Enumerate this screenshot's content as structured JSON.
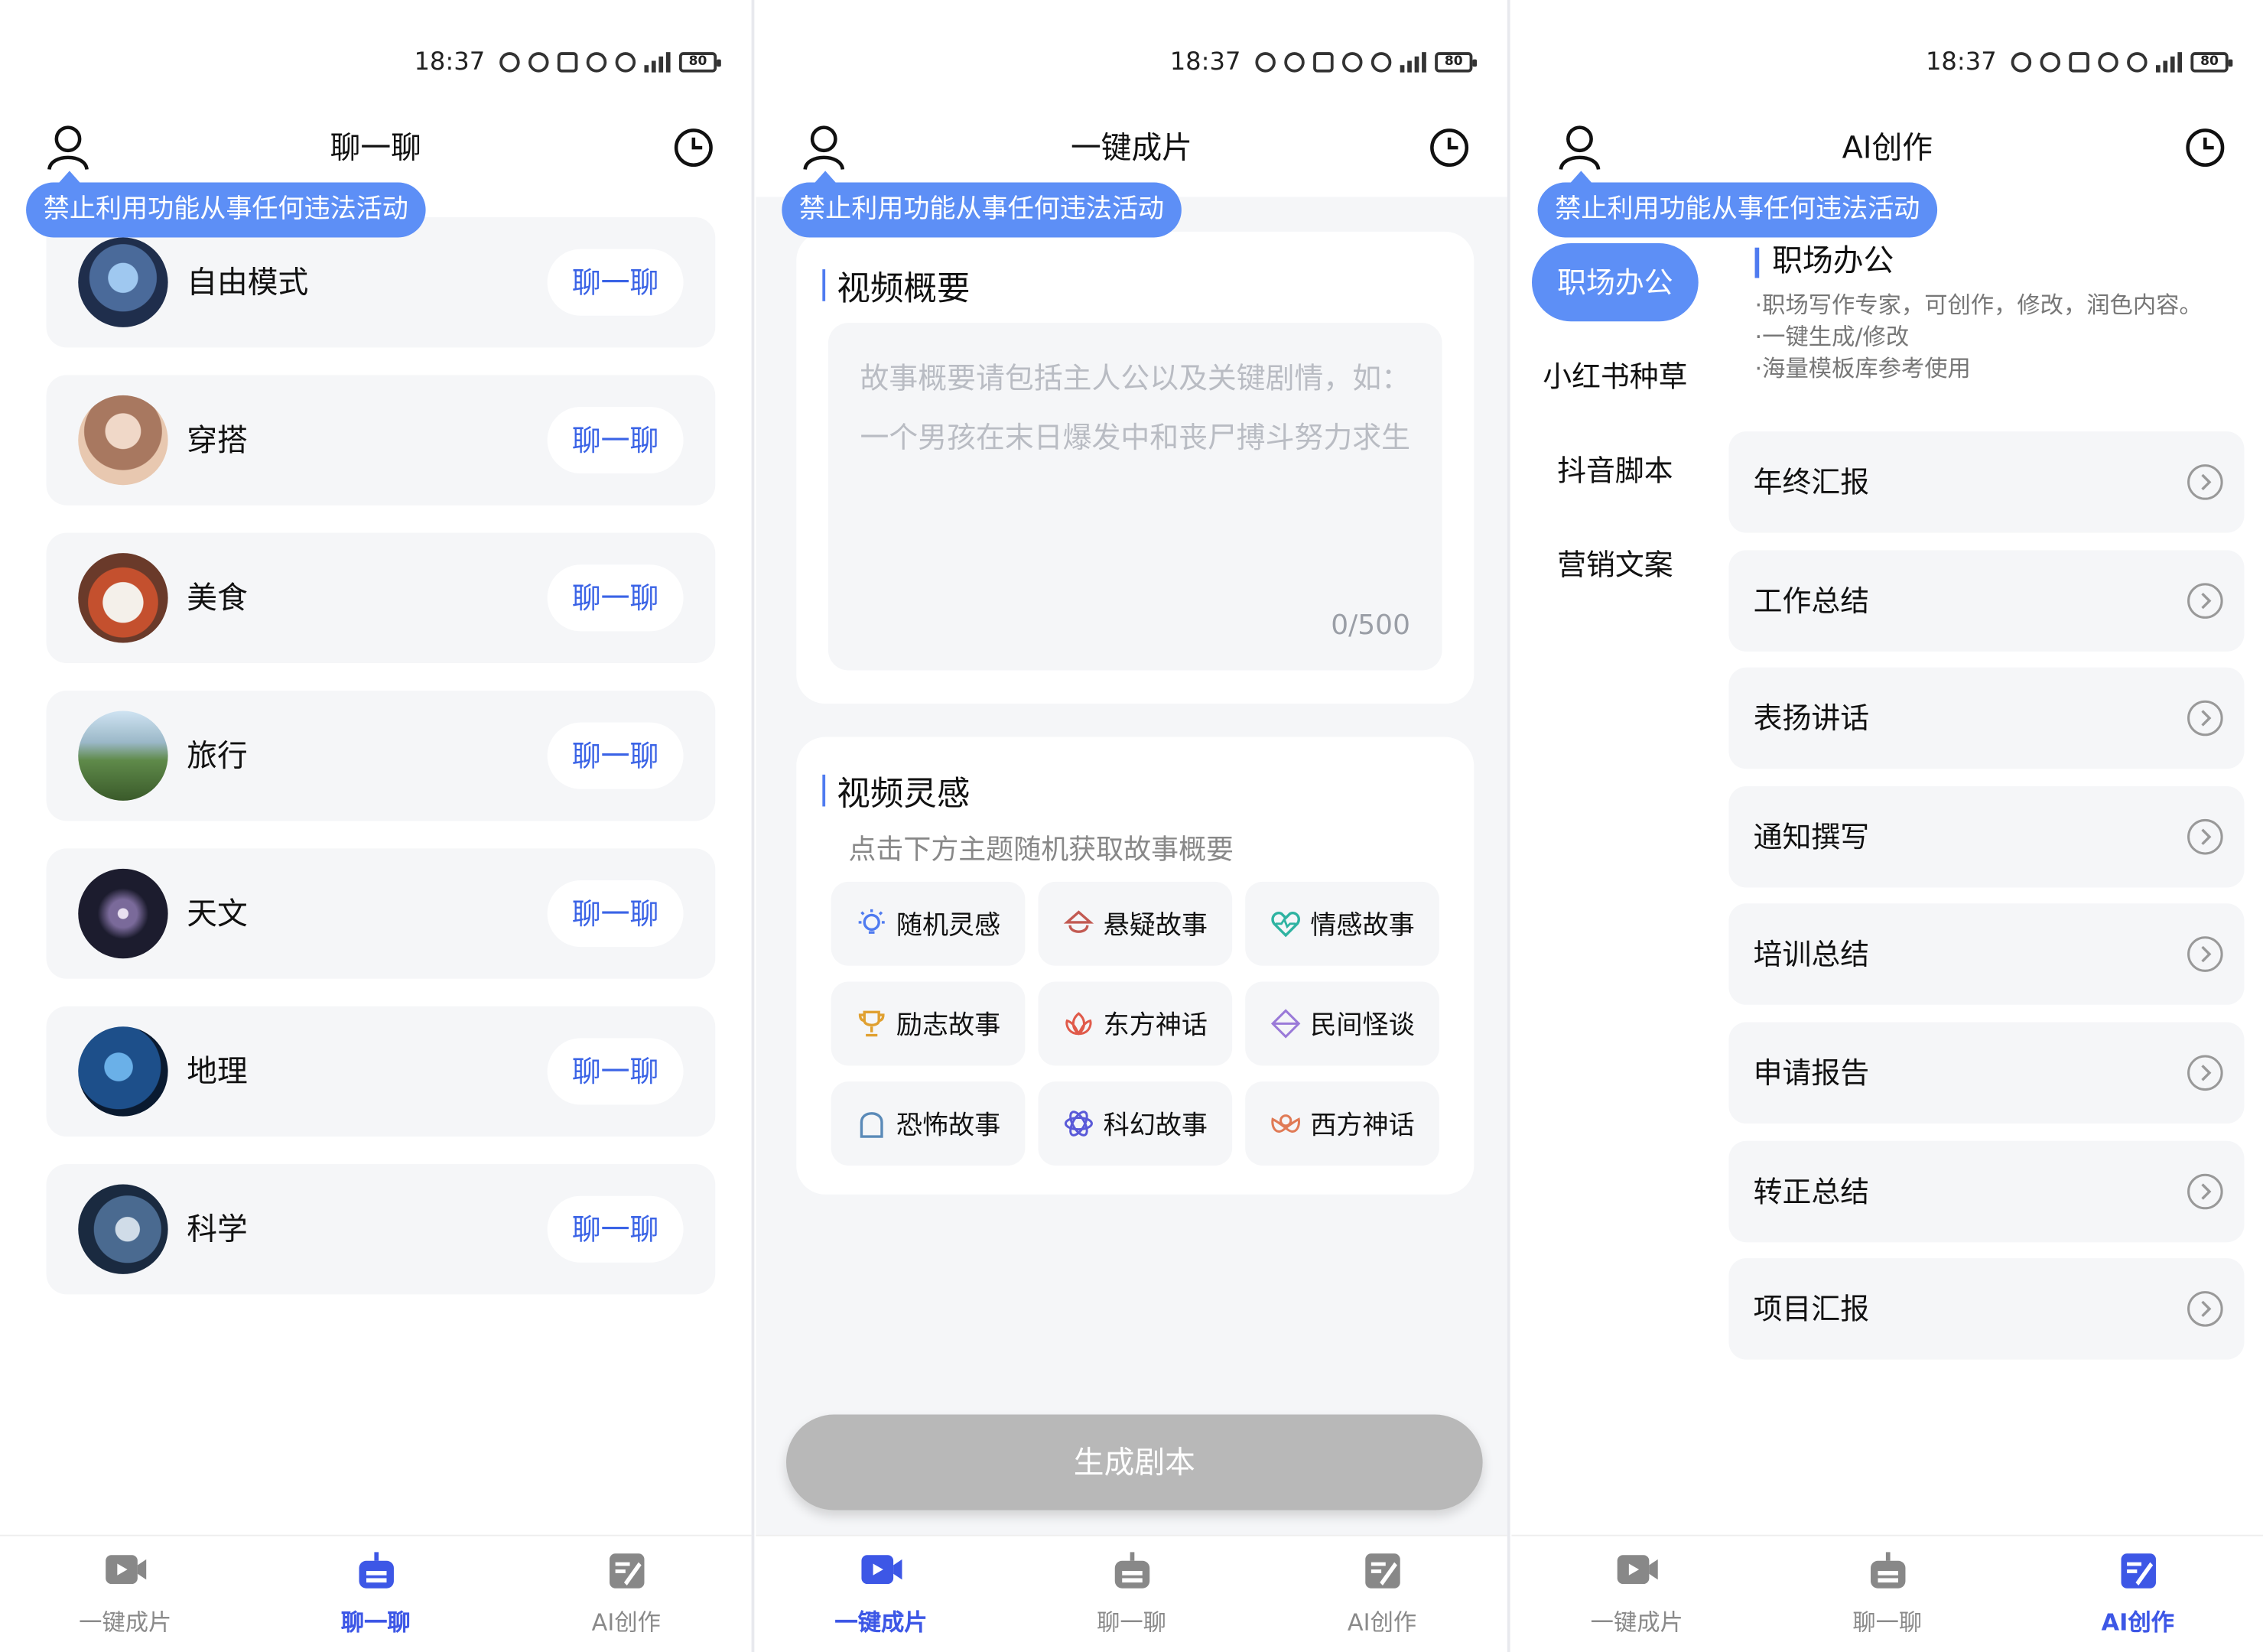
{
  "status": {
    "time": "18:37",
    "battery": "80"
  },
  "notice": "禁止利用功能从事任何违法活动",
  "tabs": [
    {
      "label": "一键成片",
      "icon": "video-icon"
    },
    {
      "label": "聊一聊",
      "icon": "robot-icon"
    },
    {
      "label": "AI创作",
      "icon": "edit-doc-icon"
    }
  ],
  "panel1": {
    "title": "聊一聊",
    "items": [
      {
        "name": "自由模式",
        "button": "聊一聊",
        "avatar_color": "#2a3f66"
      },
      {
        "name": "穿搭",
        "button": "聊一聊",
        "avatar_color": "#c99a86"
      },
      {
        "name": "美食",
        "button": "聊一聊",
        "avatar_color": "#c4502e"
      },
      {
        "name": "旅行",
        "button": "聊一聊",
        "avatar_color": "#5f8a4a"
      },
      {
        "name": "天文",
        "button": "聊一聊",
        "avatar_color": "#1c1c2e"
      },
      {
        "name": "地理",
        "button": "聊一聊",
        "avatar_color": "#1d4f8a"
      },
      {
        "name": "科学",
        "button": "聊一聊",
        "avatar_color": "#2f4f75"
      }
    ]
  },
  "panel2": {
    "title": "一键成片",
    "summary_title": "视频概要",
    "summary_placeholder": "故事概要请包括主人公以及关键剧情，如：一个男孩在末日爆发中和丧尸搏斗努力求生",
    "summary_counter": "0/500",
    "inspire_title": "视频灵感",
    "inspire_hint": "点击下方主题随机获取故事概要",
    "chips": [
      {
        "label": "随机灵感",
        "icon": "lightbulb-icon",
        "color": "#4f7bf0"
      },
      {
        "label": "悬疑故事",
        "icon": "detective-icon",
        "color": "#c25a52"
      },
      {
        "label": "情感故事",
        "icon": "heartbeat-icon",
        "color": "#2eb3a1"
      },
      {
        "label": "励志故事",
        "icon": "trophy-icon",
        "color": "#e0a030"
      },
      {
        "label": "东方神话",
        "icon": "lotus-icon",
        "color": "#e05a4a"
      },
      {
        "label": "民间怪谈",
        "icon": "lantern-icon",
        "color": "#9a7ad8"
      },
      {
        "label": "恐怖故事",
        "icon": "ghost-icon",
        "color": "#5a8ab8"
      },
      {
        "label": "科幻故事",
        "icon": "atom-icon",
        "color": "#5a5ad8"
      },
      {
        "label": "西方神话",
        "icon": "angel-icon",
        "color": "#e07a55"
      }
    ],
    "generate_button": "生成剧本"
  },
  "panel3": {
    "title": "AI创作",
    "categories": [
      "职场办公",
      "小红书种草",
      "抖音脚本",
      "营销文案"
    ],
    "desc_title": "职场办公",
    "desc_lines": [
      "·职场写作专家，可创作，修改，润色内容。",
      "·一键生成/修改",
      "·海量模板库参考使用"
    ],
    "templates": [
      "年终汇报",
      "工作总结",
      "表扬讲话",
      "通知撰写",
      "培训总结",
      "申请报告",
      "转正总结",
      "项目汇报"
    ]
  }
}
